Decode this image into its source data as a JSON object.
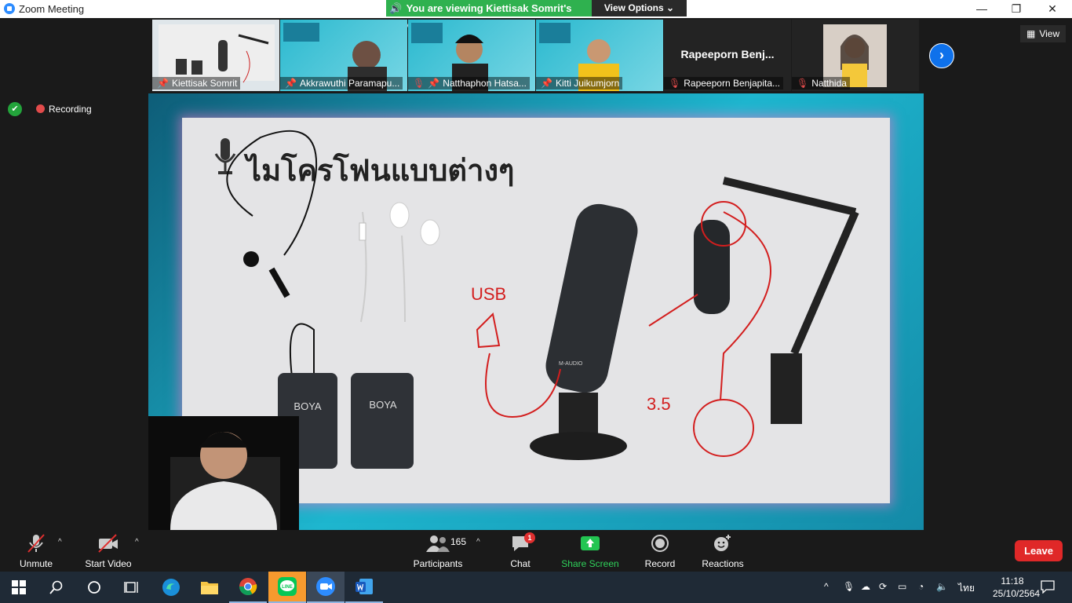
{
  "window": {
    "title": "Zoom Meeting",
    "minimize": "—",
    "restore": "❐",
    "close": "✕"
  },
  "banner": {
    "viewing_text": "You are viewing Kiettisak Somrit's screen",
    "view_options_label": "View Options"
  },
  "view_button": {
    "label": "View"
  },
  "thumbnails": [
    {
      "name": "Kiettisak Somrit",
      "muted": false
    },
    {
      "name": "Akkrawuthi Paramapu...",
      "muted": false
    },
    {
      "name": "Natthaphon Hatsa...",
      "muted": true
    },
    {
      "name": "Kitti Juikumjorn",
      "muted": false
    },
    {
      "name": "Rapeeporn Benjapita...",
      "muted": true,
      "display_name": "Rapeeporn  Benj..."
    },
    {
      "name": "Natthida",
      "muted": true
    }
  ],
  "status": {
    "recording_label": "Recording"
  },
  "slide": {
    "title": "ไมโครโฟนแบบต่างๆ",
    "annotations": {
      "usb": "USB",
      "jack": "3.5"
    },
    "brand": "BOYA",
    "usb_mic_brand": "M-AUDIO"
  },
  "toolbar": {
    "unmute": "Unmute",
    "start_video": "Start Video",
    "participants": "Participants",
    "participant_count": "165",
    "chat": "Chat",
    "chat_badge": "1",
    "share_screen": "Share Screen",
    "record": "Record",
    "reactions": "Reactions",
    "leave": "Leave"
  },
  "taskbar": {
    "language": "ไทย",
    "time": "11:18",
    "date": "25/10/2564",
    "line_label": "LINE"
  }
}
